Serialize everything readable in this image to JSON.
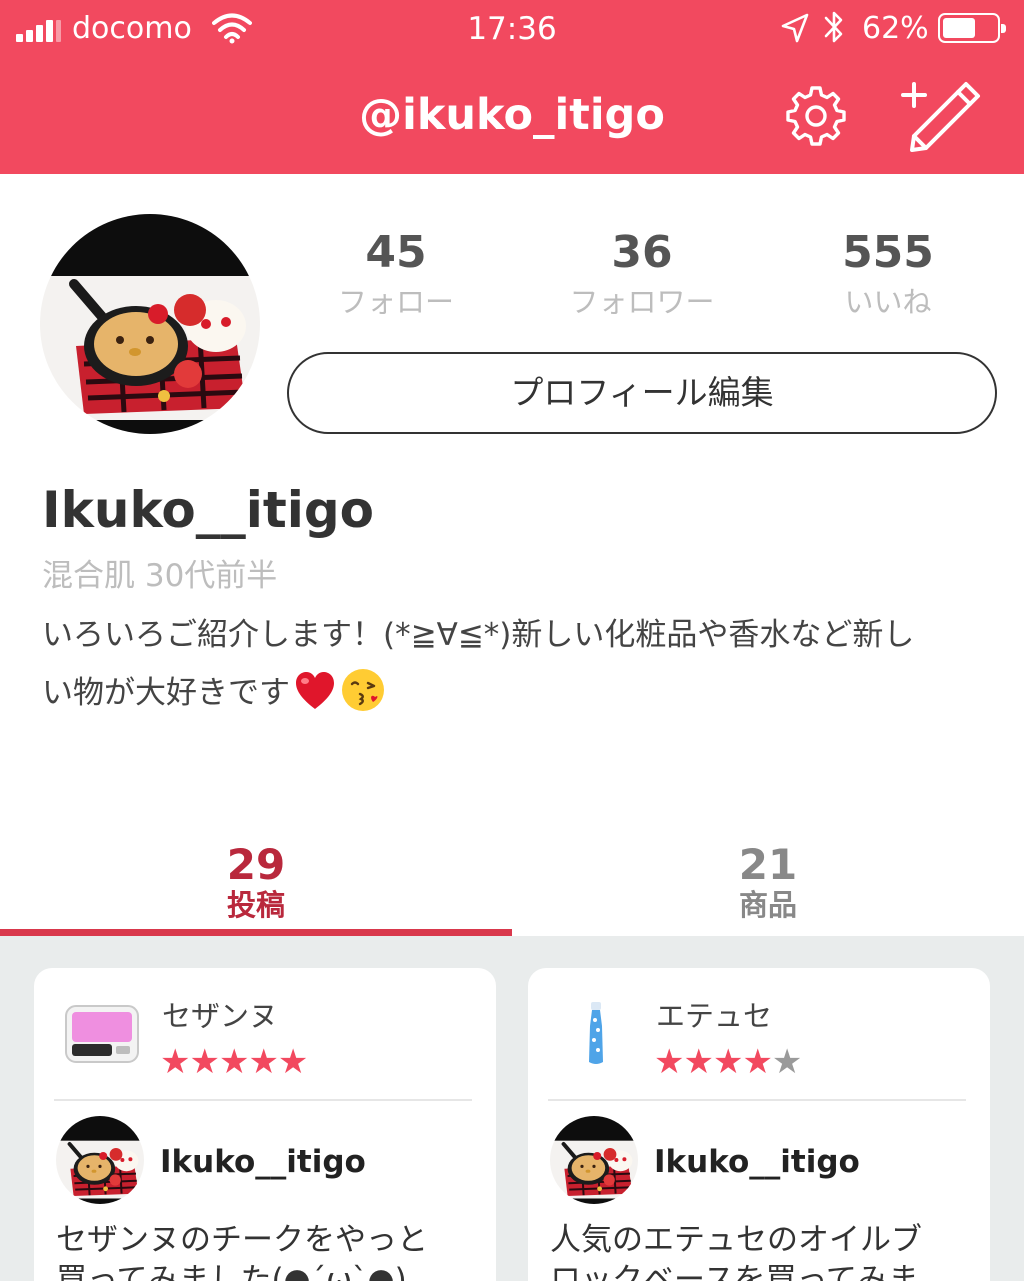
{
  "status_bar": {
    "carrier": "docomo",
    "time": "17:36",
    "battery_percent": "62%",
    "battery_level": 0.62,
    "signal_bars": 4
  },
  "nav": {
    "title": "@ikuko_itigo",
    "settings_icon": "gear-icon",
    "compose_icon": "compose-pencil-icon"
  },
  "profile": {
    "stats": [
      {
        "count": "45",
        "label": "フォロー"
      },
      {
        "count": "36",
        "label": "フォロワー"
      },
      {
        "count": "555",
        "label": "いいね"
      }
    ],
    "edit_label": "プロフィール編集",
    "display_name": "Ikuko__itigo",
    "skin_info": "混合肌  30代前半",
    "bio_line1": "いろいろご紹介します！(*≧∀≦*)新しい化粧品や香水など新し",
    "bio_line2": "い物が大好きです"
  },
  "tabs": [
    {
      "count": "29",
      "label": "投稿"
    },
    {
      "count": "21",
      "label": "商品"
    }
  ],
  "posts": [
    {
      "product": "セザンヌ",
      "rating": 5,
      "stars_on": "★★★★★",
      "stars_off": "",
      "author": "Ikuko__itigo",
      "excerpt_line1": "セザンヌのチークをやっと",
      "excerpt_line2": "買ってみました(●´ω`●)"
    },
    {
      "product": "エテュセ",
      "rating": 4,
      "stars_on": "★★★★",
      "stars_off": "★",
      "author": "Ikuko__itigo",
      "excerpt_line1": "人気のエテュセのオイルブ",
      "excerpt_line2": "ロックベースを買ってみま"
    }
  ],
  "colors": {
    "brand": "#f2495f",
    "active_tab": "#b9283c",
    "feed_background": "#e9ecec"
  }
}
